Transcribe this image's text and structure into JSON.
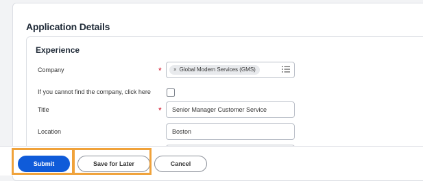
{
  "page": {
    "section_title": "Application Details",
    "subsection_title": "Experience"
  },
  "form": {
    "company": {
      "label": "Company",
      "required_mark": "*",
      "selected_value": "Global Modern Services (GMS)",
      "remove_glyph": "×"
    },
    "cannot_find": {
      "label": "If you cannot find the company, click here",
      "checked": false
    },
    "title": {
      "label": "Title",
      "required_mark": "*",
      "value": "Senior Manager Customer Service"
    },
    "location": {
      "label": "Location",
      "value": "Boston"
    }
  },
  "actions": {
    "submit_label": "Submit",
    "save_label": "Save for Later",
    "cancel_label": "Cancel"
  },
  "colors": {
    "primary": "#0f5bd9",
    "required": "#d0021b",
    "highlight": "#f0a23a"
  }
}
